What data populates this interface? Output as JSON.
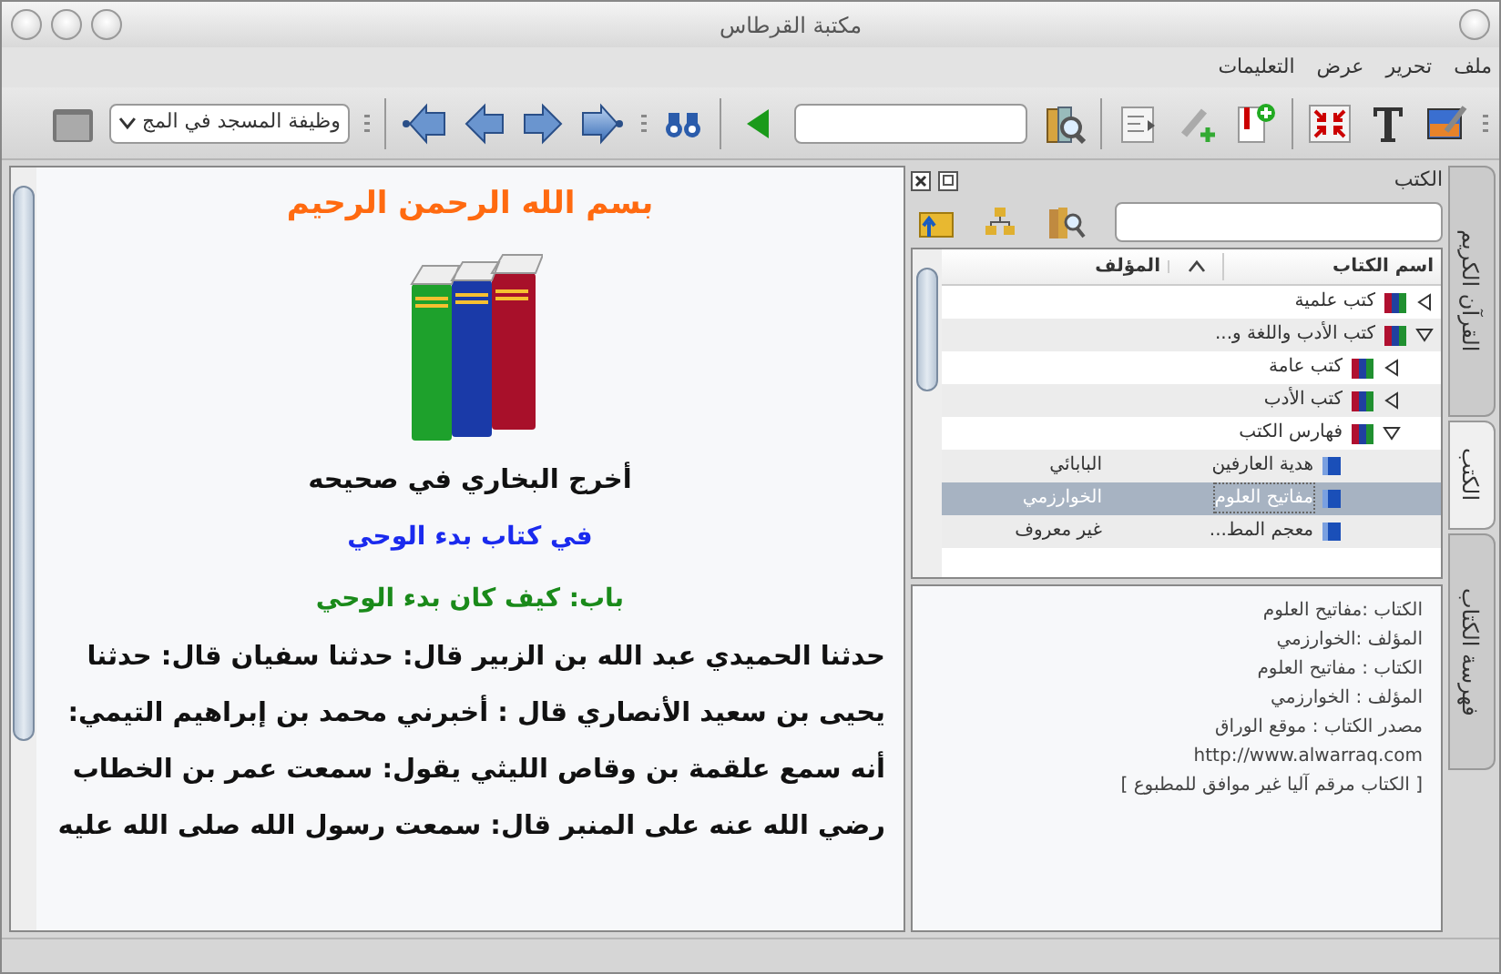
{
  "window": {
    "title": "مكتبة القرطاس"
  },
  "menu": [
    {
      "label": "ملف"
    },
    {
      "label": "تحرير"
    },
    {
      "label": "عرض"
    },
    {
      "label": "التعليمات"
    }
  ],
  "toolbar": {
    "combo": {
      "value": "وظيفة المسجد في المج"
    }
  },
  "reader": {
    "heading": "بسم الله الرحمن الرحيم",
    "subtitle": "أخرج البخاري في صحيحه",
    "chapter": "في كتاب بدء الوحي",
    "section": "باب: كيف كان بدء الوحي",
    "lines": [
      "حدثنا الحميدي عبد الله بن الزبير قال: حدثنا سفيان قال: حدثنا",
      "يحيى بن سعيد الأنصاري قال : أخبرني محمد بن إبراهيم التيمي:",
      "أنه سمع علقمة بن وقاص الليثي يقول: سمعت عمر بن الخطاب",
      "رضي الله عنه على المنبر قال: سمعت رسول الله صلى الله عليه"
    ]
  },
  "panel": {
    "title": "الكتب",
    "columns": [
      "اسم الكتاب",
      "المؤلف"
    ],
    "tree": [
      {
        "kind": "category",
        "title": "كتب علمية",
        "expanded": false,
        "selected": false
      },
      {
        "kind": "category",
        "title": "كتب الأدب واللغة و...",
        "expanded": true,
        "selected": false,
        "children": [
          {
            "kind": "category",
            "title": "كتب عامة",
            "expanded": false,
            "selected": false
          },
          {
            "kind": "category",
            "title": "كتب الأدب",
            "expanded": false,
            "selected": false
          },
          {
            "kind": "category",
            "title": "فهارس الكتب",
            "expanded": true,
            "selected": false,
            "children": [
              {
                "kind": "book",
                "title": "هدية العارفين",
                "author": "البابائي",
                "selected": false
              },
              {
                "kind": "book",
                "title": "مفاتيح العلوم",
                "author": "الخوارزمي",
                "selected": true
              },
              {
                "kind": "book",
                "title": "معجم المط...",
                "author": "غير معروف",
                "selected": false
              }
            ]
          }
        ]
      }
    ],
    "details": [
      "الكتاب :مفاتيح العلوم",
      "المؤلف :الخوارزمي",
      "الكتاب : مفاتيح العلوم",
      "المؤلف : الخوارزمي",
      "مصدر الكتاب : موقع الوراق",
      "http://www.alwarraq.com",
      "[ الكتاب مرقم آليا غير موافق للمطبوع ]"
    ]
  },
  "side_tabs": [
    {
      "label": "القرآن الكريم",
      "selected": false
    },
    {
      "label": "الكتب",
      "selected": true
    },
    {
      "label": "فهرسة الكتاب",
      "selected": false
    }
  ]
}
